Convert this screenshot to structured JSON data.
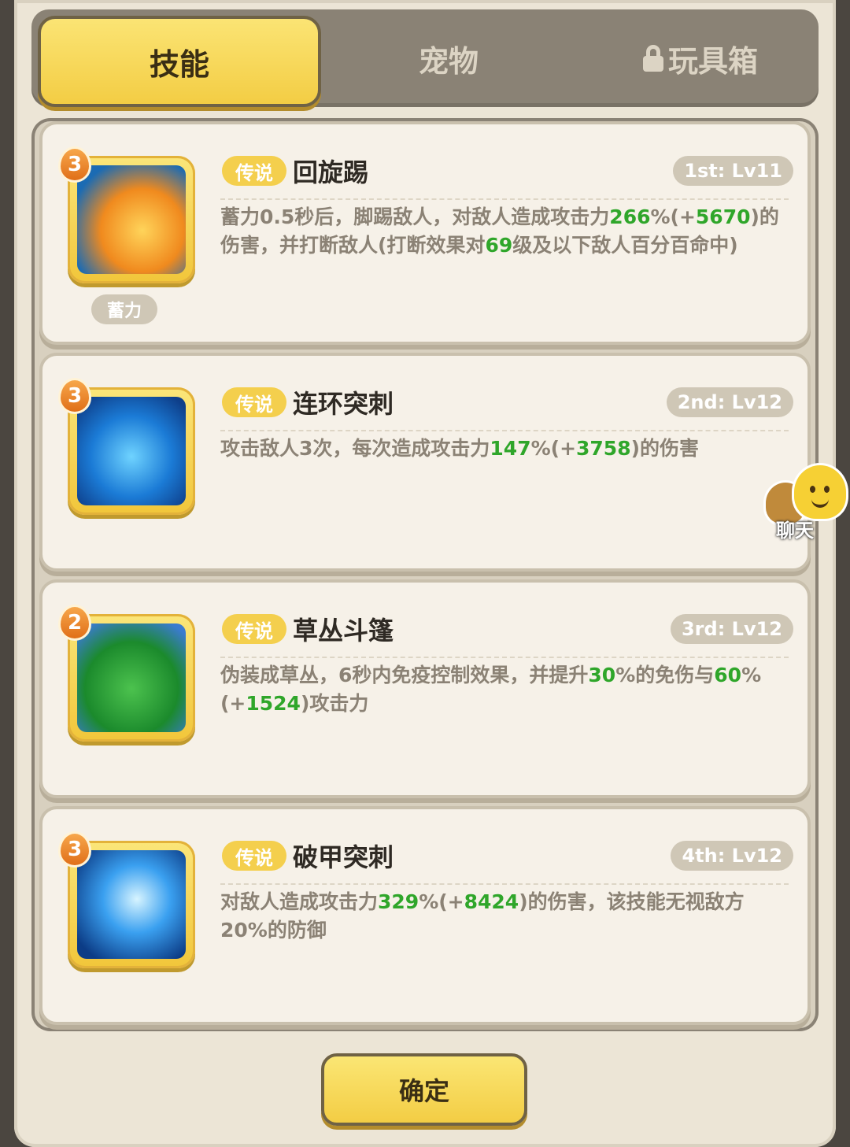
{
  "tabs": [
    {
      "label": "技能",
      "active": true
    },
    {
      "label": "宠物",
      "active": false
    },
    {
      "label": "玩具箱",
      "active": false,
      "locked": true
    }
  ],
  "skills": [
    {
      "rank": "3",
      "badge": "传说",
      "name": "回旋踢",
      "level": "1st: Lv11",
      "tag": "蓄力",
      "desc": [
        {
          "t": "蓄力0.5秒后，脚踢敌人，对敌人造成攻击力",
          "g": false
        },
        {
          "t": "266",
          "g": true
        },
        {
          "t": "%(+",
          "g": false
        },
        {
          "t": "5670",
          "g": true
        },
        {
          "t": ")的伤害，并打断敌人(打断效果对",
          "g": false
        },
        {
          "t": "69",
          "g": true
        },
        {
          "t": "级及以下敌人百分百命中)",
          "g": false
        }
      ]
    },
    {
      "rank": "3",
      "badge": "传说",
      "name": "连环突刺",
      "level": "2nd: Lv12",
      "desc": [
        {
          "t": "攻击敌人3次，每次造成攻击力",
          "g": false
        },
        {
          "t": "147",
          "g": true
        },
        {
          "t": "%(+",
          "g": false
        },
        {
          "t": "3758",
          "g": true
        },
        {
          "t": ")的伤害",
          "g": false
        }
      ]
    },
    {
      "rank": "2",
      "badge": "传说",
      "name": "草丛斗篷",
      "level": "3rd: Lv12",
      "desc": [
        {
          "t": "伪装成草丛，6秒内免疫控制效果，并提升",
          "g": false
        },
        {
          "t": "30",
          "g": true
        },
        {
          "t": "%的免伤与",
          "g": false
        },
        {
          "t": "60",
          "g": true
        },
        {
          "t": "%(+",
          "g": false
        },
        {
          "t": "1524",
          "g": true
        },
        {
          "t": ")攻击力",
          "g": false
        }
      ]
    },
    {
      "rank": "3",
      "badge": "传说",
      "name": "破甲突刺",
      "level": "4th: Lv12",
      "desc": [
        {
          "t": "对敌人造成攻击力",
          "g": false
        },
        {
          "t": "329",
          "g": true
        },
        {
          "t": "%(+",
          "g": false
        },
        {
          "t": "8424",
          "g": true
        },
        {
          "t": ")的伤害，该技能无视敌方20%的防御",
          "g": false
        }
      ]
    }
  ],
  "chat": {
    "label": "聊天"
  },
  "confirm_label": "确定",
  "colors": {
    "accent_green": "#2fa62a",
    "button_yellow": "#f3cd44",
    "badge_yellow": "#f4cf4d"
  }
}
